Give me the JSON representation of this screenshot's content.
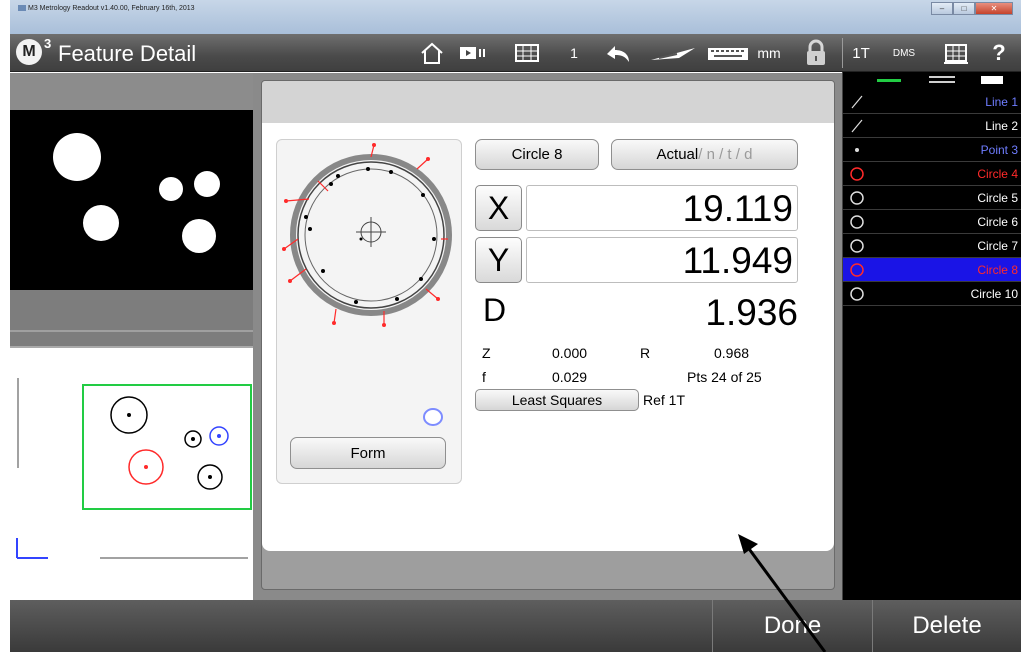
{
  "window": {
    "title": "M3 Metrology Readout  v1.40.00, February 16th, 2013"
  },
  "app": {
    "logo": "M",
    "logo_sup": "3",
    "title": "Feature Detail"
  },
  "toolbar": {
    "page_number": "1",
    "units": "mm",
    "ref": "1T",
    "angle_format": "DMS",
    "help": "?",
    "icons": [
      "home-icon",
      "video-icon",
      "grid-icon",
      "undo-icon",
      "probe-icon",
      "keyboard-icon",
      "lock-icon",
      "table-icon",
      "help-icon"
    ]
  },
  "feature": {
    "name_button": "Circle 8",
    "mode_active": "Actual",
    "mode_inactive": " / n / t / d",
    "x_label": "X",
    "x_value": "19.119",
    "y_label": "Y",
    "y_value": "11.949",
    "d_label": "D",
    "d_value": "1.936",
    "z_label": "Z",
    "z_value": "0.000",
    "r_label": "R",
    "r_value": "0.968",
    "f_label": "f",
    "f_value": "0.029",
    "pts": "Pts 24 of 25",
    "fit_button": "Least Squares",
    "ref_text": "Ref 1T",
    "form_button": "Form"
  },
  "feature_list": [
    {
      "icon": "line-icon",
      "label": "Line 1",
      "color": "#6f7dff",
      "selected": false
    },
    {
      "icon": "line-icon",
      "label": "Line 2",
      "color": "#ffffff",
      "selected": false
    },
    {
      "icon": "point-icon",
      "label": "Point 3",
      "color": "#6f7dff",
      "selected": false
    },
    {
      "icon": "circle-icon",
      "label": "Circle 4",
      "color": "#ff2a2a",
      "selected": false
    },
    {
      "icon": "circle-icon",
      "label": "Circle 5",
      "color": "#ffffff",
      "selected": false
    },
    {
      "icon": "circle-icon",
      "label": "Circle 6",
      "color": "#ffffff",
      "selected": false
    },
    {
      "icon": "circle-icon",
      "label": "Circle 7",
      "color": "#ffffff",
      "selected": false
    },
    {
      "icon": "circle-icon",
      "label": "Circle 8",
      "color": "#ff2a2a",
      "selected": true
    },
    {
      "icon": "circle-icon",
      "label": "Circle 10",
      "color": "#ffffff",
      "selected": false
    }
  ],
  "bottom": {
    "done": "Done",
    "delete": "Delete"
  },
  "colors": {
    "selection": "#1a14e6",
    "accent_red": "#ff2a2a",
    "accent_blue": "#6f7dff",
    "frame_green": "#22cc44"
  }
}
